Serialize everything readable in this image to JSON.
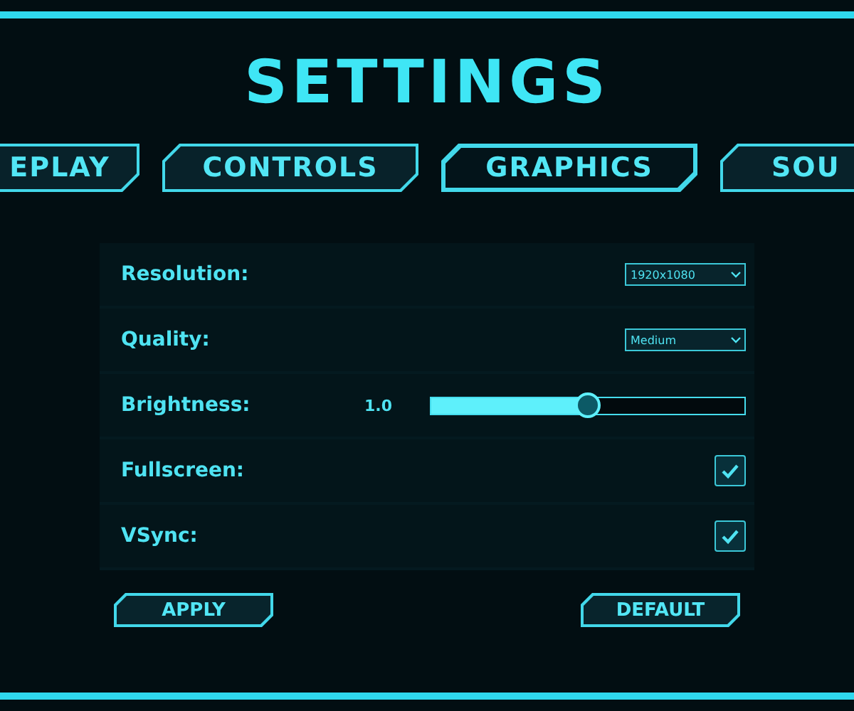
{
  "title": "SETTINGS",
  "tabs": [
    {
      "label": "EPLAY",
      "selected": false
    },
    {
      "label": "CONTROLS",
      "selected": false
    },
    {
      "label": "GRAPHICS",
      "selected": true
    },
    {
      "label": "SOU",
      "selected": false
    }
  ],
  "settings": [
    {
      "kind": "select",
      "label": "Resolution:",
      "value": "1920x1080"
    },
    {
      "kind": "select",
      "label": "Quality:",
      "value": "Medium"
    },
    {
      "kind": "slider",
      "label": "Brightness:",
      "reading": "1.0",
      "level": 0.5
    },
    {
      "kind": "checkbox",
      "label": "Fullscreen:",
      "checked": true
    },
    {
      "kind": "checkbox",
      "label": "VSync:",
      "checked": true
    }
  ],
  "buttons": [
    "APPLY",
    "DEFAULT"
  ]
}
